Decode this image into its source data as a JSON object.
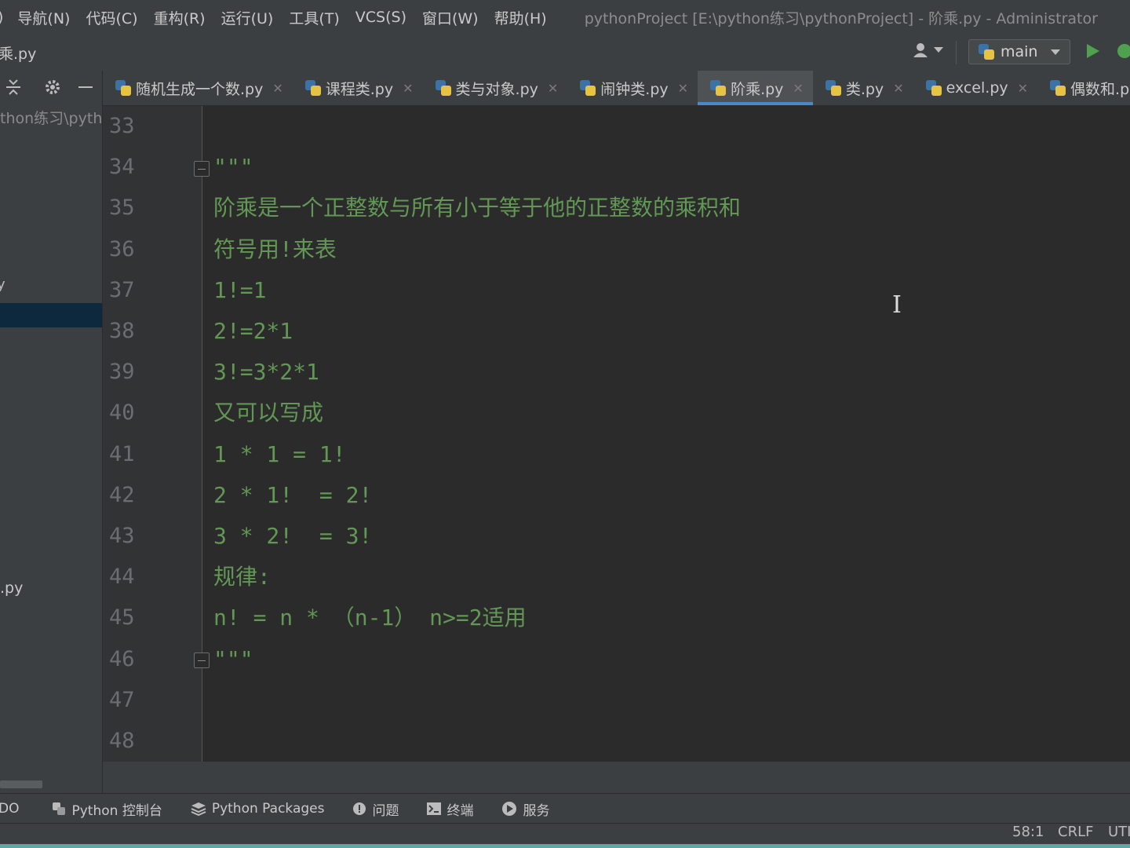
{
  "menubar": {
    "fragment": ")",
    "items": [
      "导航(N)",
      "代码(C)",
      "重构(R)",
      "运行(U)",
      "工具(T)",
      "VCS(S)",
      "窗口(W)",
      "帮助(H)"
    ],
    "window_title": "pythonProject [E:\\python练习\\pythonProject] - 阶乘.py - Administrator"
  },
  "navbar": {
    "breadcrumb": "乘.py",
    "branch": "main"
  },
  "project_panel": {
    "path_fragment": "thon练习\\pyth",
    "frag_y": "y",
    "frag_py": ".py"
  },
  "tabs": [
    {
      "label": "随机生成一个数.py",
      "active": false
    },
    {
      "label": "课程类.py",
      "active": false
    },
    {
      "label": "类与对象.py",
      "active": false
    },
    {
      "label": "闹钟类.py",
      "active": false
    },
    {
      "label": "阶乘.py",
      "active": true
    },
    {
      "label": "类.py",
      "active": false
    },
    {
      "label": "excel.py",
      "active": false
    },
    {
      "label": "偶数和.py",
      "active": false
    }
  ],
  "editor": {
    "lines": [
      {
        "num": "33",
        "text": ""
      },
      {
        "num": "34",
        "text": "\"\"\""
      },
      {
        "num": "35",
        "text": "阶乘是一个正整数与所有小于等于他的正整数的乘积和"
      },
      {
        "num": "36",
        "text": "符号用!来表"
      },
      {
        "num": "37",
        "text": "1!=1"
      },
      {
        "num": "38",
        "text": "2!=2*1"
      },
      {
        "num": "39",
        "text": "3!=3*2*1"
      },
      {
        "num": "40",
        "text": "又可以写成"
      },
      {
        "num": "41",
        "text": "1 * 1 = 1!"
      },
      {
        "num": "42",
        "text": "2 * 1!  = 2!"
      },
      {
        "num": "43",
        "text": "3 * 2!  = 3!"
      },
      {
        "num": "44",
        "text": "规律:"
      },
      {
        "num": "45",
        "text": "n! = n * （n-1） n>=2适用"
      },
      {
        "num": "46",
        "text": "\"\"\""
      },
      {
        "num": "47",
        "text": ""
      },
      {
        "num": "48",
        "text": ""
      }
    ],
    "cursor_glyph": "I"
  },
  "tool_windows": {
    "first_fragment": "DO",
    "items": [
      {
        "label": "Python 控制台",
        "icon": "python-console-icon"
      },
      {
        "label": "Python Packages",
        "icon": "layers-icon"
      },
      {
        "label": "问题",
        "icon": "info-icon"
      },
      {
        "label": "终端",
        "icon": "terminal-icon"
      },
      {
        "label": "服务",
        "icon": "services-icon"
      }
    ]
  },
  "statusbar": {
    "position": "58:1",
    "line_ending": "CRLF",
    "encoding": "UTI"
  },
  "colors": {
    "editor_bg": "#2b2b2b",
    "docstring": "#629755",
    "line_number": "#6b6e70",
    "active_tab_underline": "#4a88c7",
    "run_green": "#4fa04f"
  }
}
